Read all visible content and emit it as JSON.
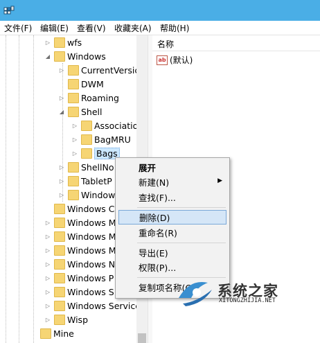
{
  "titlebar": {
    "icon": "regedit-icon"
  },
  "menu": {
    "file": "文件(F)",
    "edit": "编辑(E)",
    "view": "查看(V)",
    "favorites": "收藏夹(A)",
    "help": "帮助(H)"
  },
  "tree": {
    "items": [
      {
        "label": "wfs",
        "expander": "collapsed"
      },
      {
        "label": "Windows",
        "expander": "expanded"
      },
      {
        "label": "CurrentVersic",
        "expander": "collapsed"
      },
      {
        "label": "DWM",
        "expander": "none"
      },
      {
        "label": "Roaming",
        "expander": "collapsed"
      },
      {
        "label": "Shell",
        "expander": "expanded"
      },
      {
        "label": "Associatio",
        "expander": "collapsed"
      },
      {
        "label": "BagMRU",
        "expander": "collapsed"
      },
      {
        "label": "Bags",
        "expander": "collapsed"
      },
      {
        "label": "ShellNo",
        "expander": "collapsed"
      },
      {
        "label": "TabletP",
        "expander": "collapsed"
      },
      {
        "label": "Window",
        "expander": "collapsed"
      },
      {
        "label": "Windows C",
        "expander": "none"
      },
      {
        "label": "Windows M",
        "expander": "collapsed"
      },
      {
        "label": "Windows M",
        "expander": "collapsed"
      },
      {
        "label": "Windows M",
        "expander": "collapsed"
      },
      {
        "label": "Windows N",
        "expander": "collapsed"
      },
      {
        "label": "Windows P",
        "expander": "collapsed"
      },
      {
        "label": "Windows S",
        "expander": "collapsed"
      },
      {
        "label": "Windows Service",
        "expander": "collapsed"
      },
      {
        "label": "Wisp",
        "expander": "collapsed"
      },
      {
        "label": "Mine",
        "expander": "none"
      }
    ]
  },
  "values_pane": {
    "column_name": "名称",
    "default_value": "(默认)",
    "value_icon_text": "ab"
  },
  "context_menu": {
    "expand": "展开",
    "new": "新建(N)",
    "find": "查找(F)...",
    "delete": "删除(D)",
    "rename": "重命名(R)",
    "export": "导出(E)",
    "permissions": "权限(P)...",
    "copy_key_name": "复制项名称(C)"
  },
  "watermark": {
    "brand": "系统之家",
    "url": "XITONGZHIJIA.NET"
  },
  "colors": {
    "titlebar": "#4aaee6",
    "highlight": "#d5e6f7",
    "folder": "#f6d574"
  }
}
